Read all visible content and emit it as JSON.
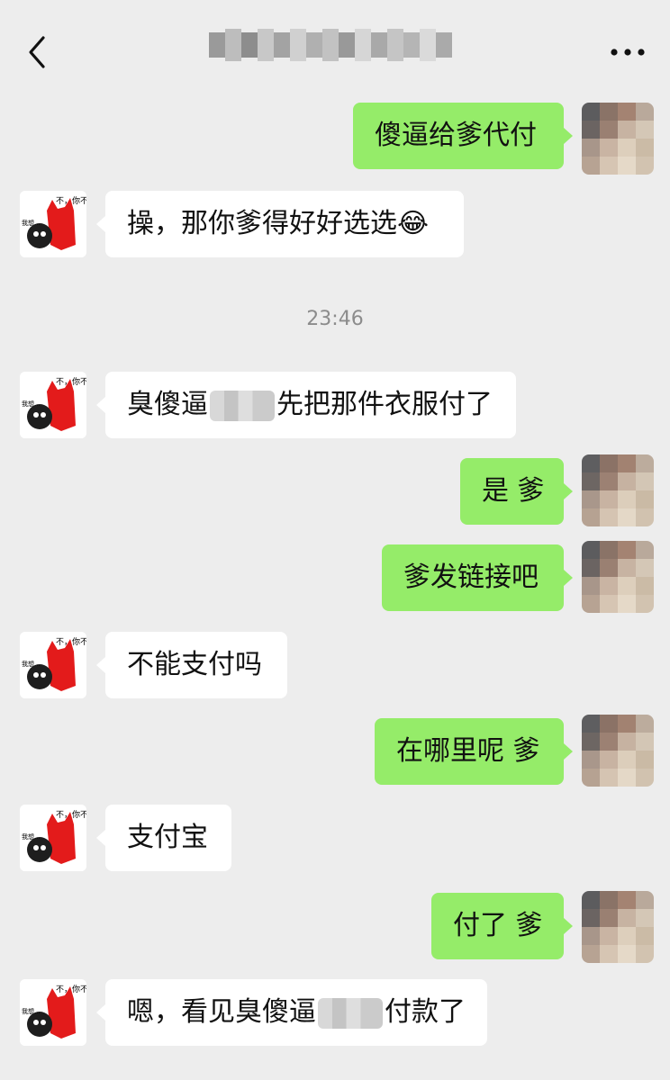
{
  "header": {
    "back_icon": "chevron-left-icon",
    "title": "",
    "more_icon": "more-horizontal-icon"
  },
  "timestamp": "23:46",
  "messages": [
    {
      "side": "right",
      "text": "傻逼给爹代付"
    },
    {
      "side": "left",
      "text": "操，那你爹得好好选选😂"
    },
    {
      "side": "left",
      "text_before": "臭傻逼",
      "text_after": "先把那件衣服付了"
    },
    {
      "side": "right",
      "text": "是 爹"
    },
    {
      "side": "right",
      "text": "爹发链接吧"
    },
    {
      "side": "left",
      "text": "不能支付吗"
    },
    {
      "side": "right",
      "text": "在哪里呢 爹"
    },
    {
      "side": "left",
      "text": "支付宝"
    },
    {
      "side": "right",
      "text": "付了 爹"
    },
    {
      "side": "left",
      "text_before": "嗯，看见臭傻逼",
      "text_after": "付款了"
    }
  ],
  "sticker_text": {
    "top": "不，你不想",
    "bottom": "我想..."
  },
  "colors": {
    "background": "#ededed",
    "outgoing_bubble": "#95ec69",
    "incoming_bubble": "#ffffff",
    "timestamp": "#8c8c8c"
  }
}
